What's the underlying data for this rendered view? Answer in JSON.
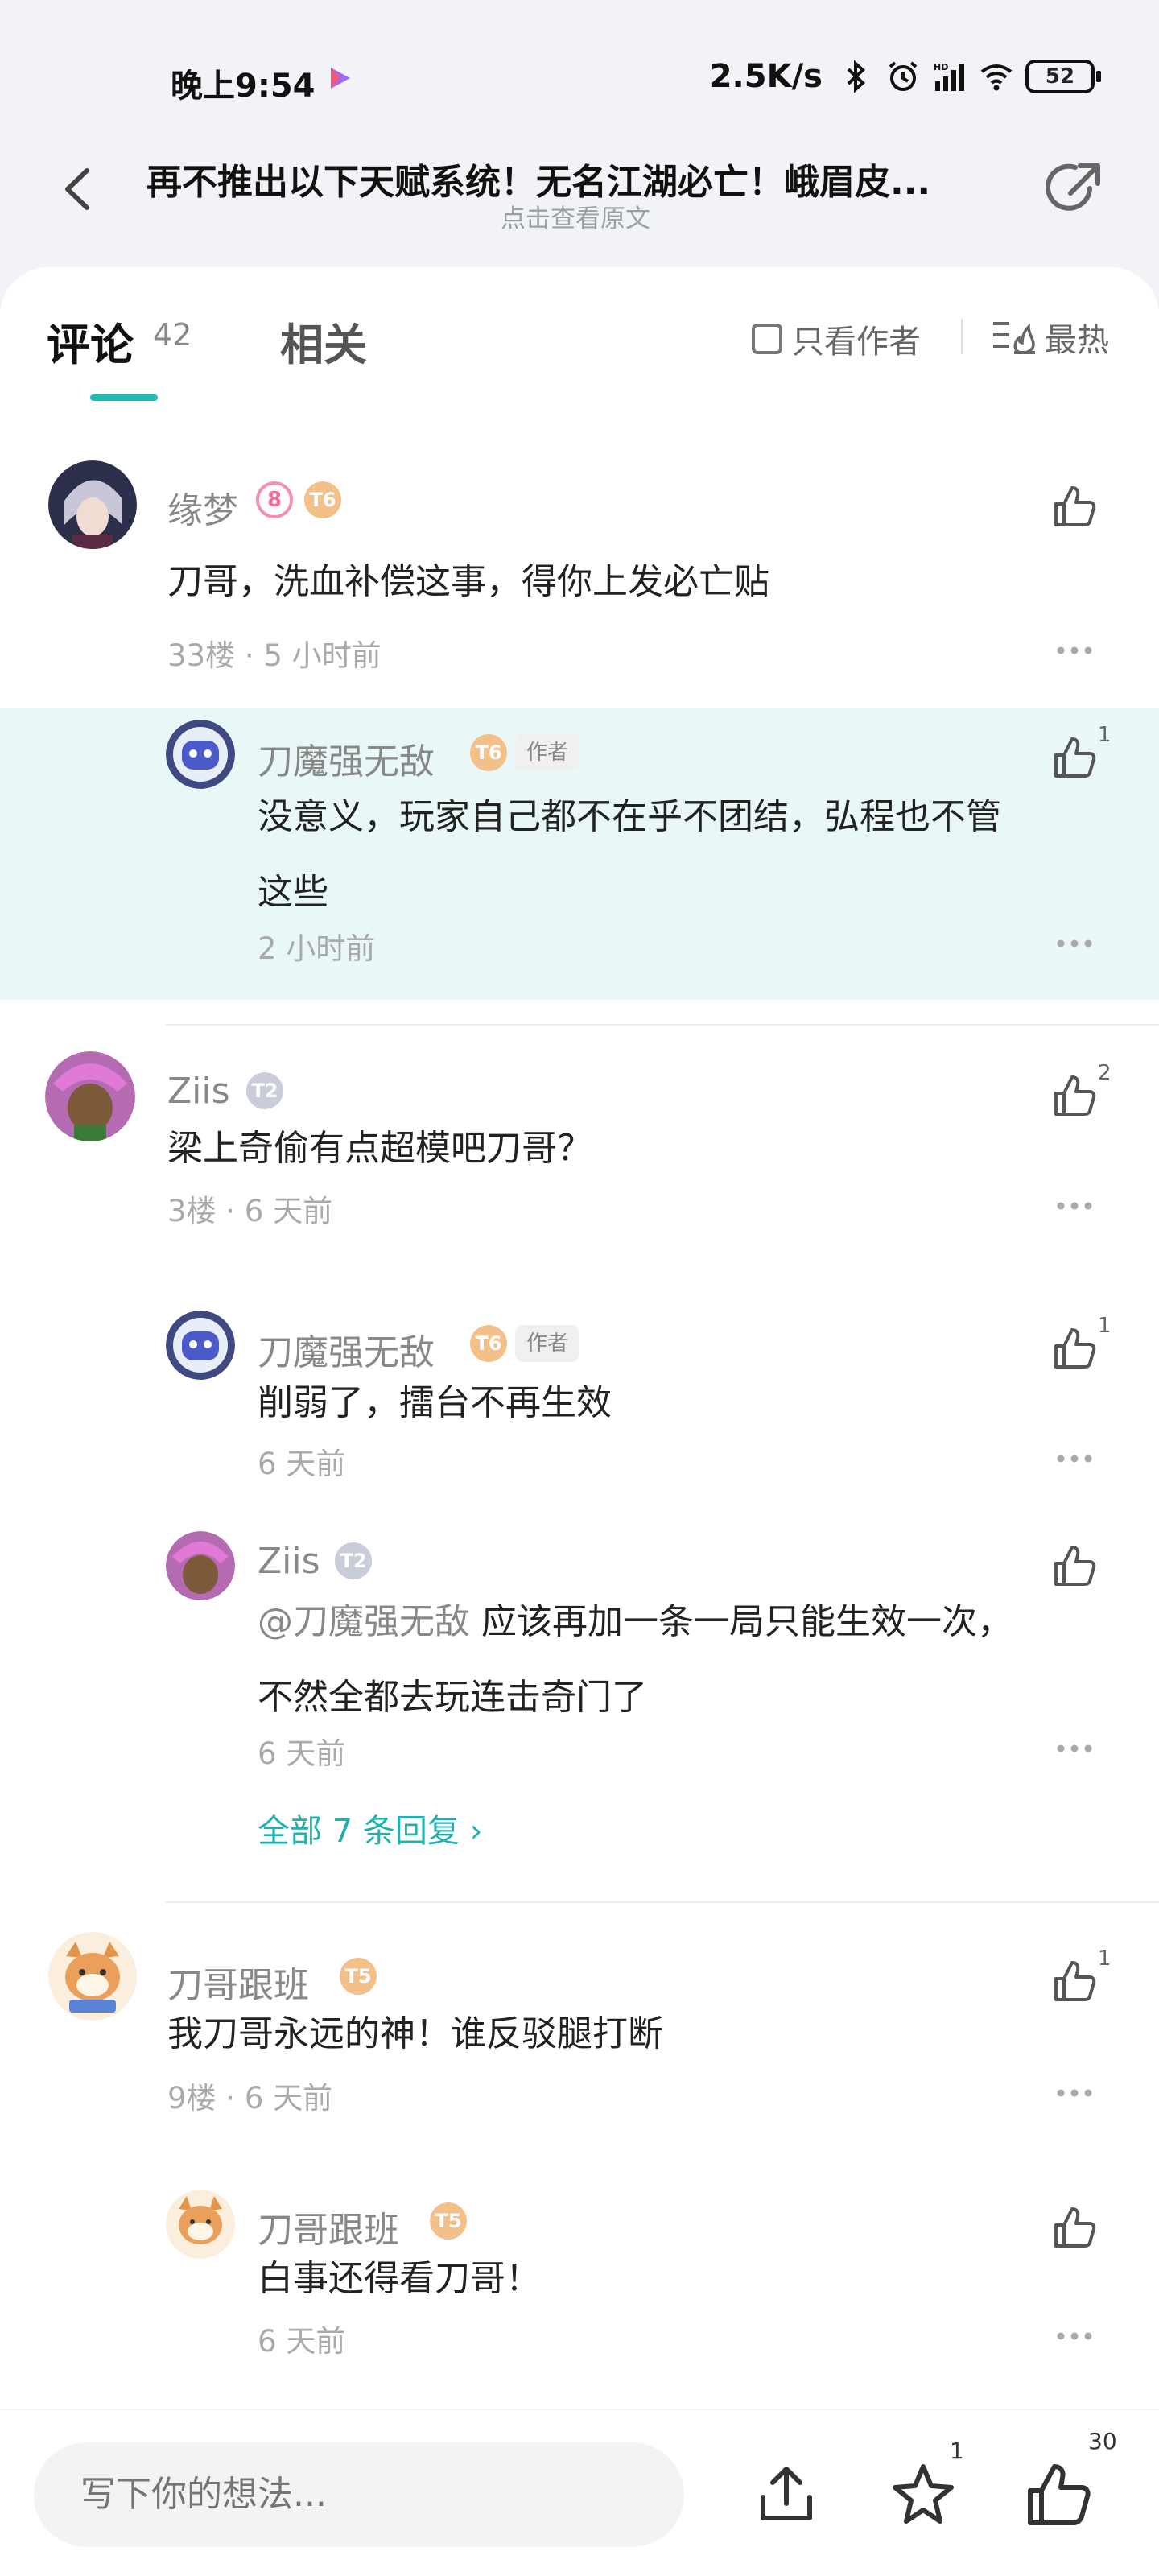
{
  "status_bar": {
    "time": "晚上9:54",
    "net_speed": "2.5K/s",
    "battery": "52"
  },
  "header": {
    "title": "再不推出以下天赋系统！无名江湖必亡！峨眉皮...",
    "subtitle": "点击查看原文"
  },
  "tabs": {
    "comments_label": "评论",
    "comments_count": "42",
    "related_label": "相关",
    "only_author_label": "只看作者",
    "sort_label": "最热"
  },
  "comments": [
    {
      "name": "缘梦",
      "badge": "T6",
      "text": "刀哥，洗血补偿这事，得你上发必亡贴",
      "meta": "33楼 · 5 小时前",
      "reply": {
        "name": "刀魔强无敌",
        "badge": "T6",
        "tag": "作者",
        "likes": "1",
        "text_line1": "没意义，玩家自己都不在乎不团结，弘程也不管",
        "text_line2": "这些",
        "time": "2 小时前"
      }
    },
    {
      "name": "Ziis",
      "badge": "T2",
      "likes": "2",
      "text": "梁上奇偷有点超模吧刀哥？",
      "meta": "3楼 · 6 天前",
      "replies": [
        {
          "name": "刀魔强无敌",
          "badge": "T6",
          "tag": "作者",
          "likes": "1",
          "text": "削弱了，擂台不再生效",
          "time": "6 天前"
        },
        {
          "name": "Ziis",
          "badge": "T2",
          "mention": "@刀魔强无敌",
          "text_line1": " 应该再加一条一局只能生效一次，",
          "text_line2": "不然全都去玩连击奇门了",
          "time": "6 天前"
        }
      ],
      "all_replies": "全部 7 条回复 ›"
    },
    {
      "name": "刀哥跟班",
      "badge": "T5",
      "likes": "1",
      "text": "我刀哥永远的神！谁反驳腿打断",
      "meta": "9楼 · 6 天前",
      "reply": {
        "name": "刀哥跟班",
        "badge": "T5",
        "text": "白事还得看刀哥！",
        "time": "6 天前"
      }
    }
  ],
  "bottom_bar": {
    "input_placeholder": "写下你的想法...",
    "star_count": "1",
    "like_count": "30"
  },
  "colors": {
    "accent": "#21b9b9",
    "highlight_bg": "#e9f7f7",
    "gold_badge": "#f3c08a",
    "silver_badge": "#c9cdd9"
  }
}
